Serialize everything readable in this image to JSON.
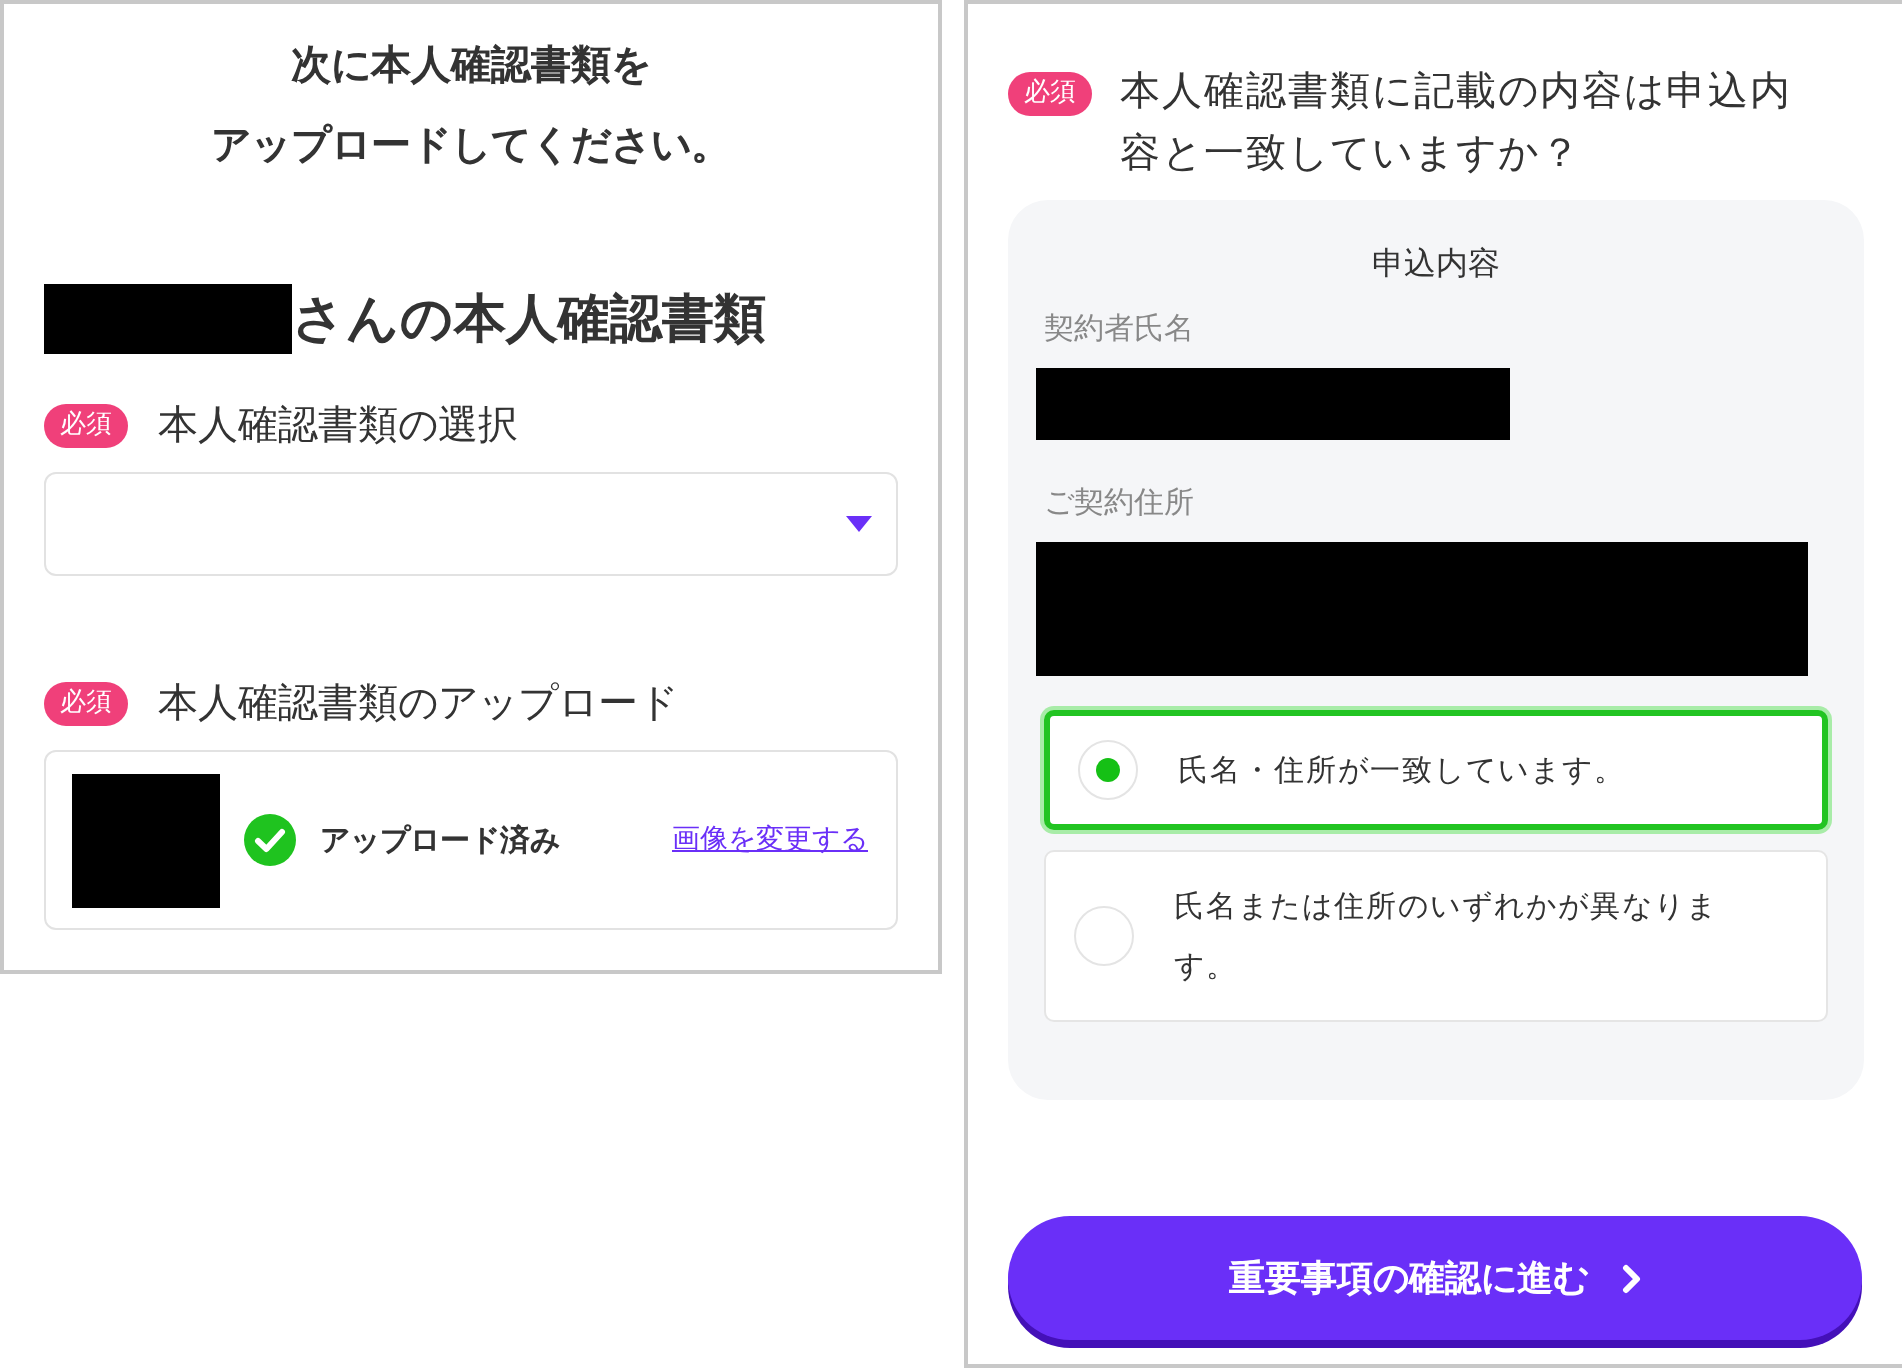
{
  "upload_panel": {
    "title_lines": [
      "次に本人確認書類を",
      "アップロードしてください。"
    ],
    "owner_heading": "さんの本人確認書類",
    "document_select": {
      "required_badge": "必須",
      "label": "本人確認書類の選択"
    },
    "upload": {
      "required_badge": "必須",
      "label": "本人確認書類のアップロード",
      "uploaded": true,
      "status": "アップロード済み",
      "change_link": "画像を変更する"
    }
  },
  "confirmation_panel": {
    "required_badge": "必須",
    "question": "本人確認書類に記載の内容は申込内容と一致していますか？",
    "summary": {
      "title": "申込内容",
      "fields": [
        {
          "label": "契約者氏名",
          "kind": "single_line"
        },
        {
          "label": "ご契約住所",
          "kind": "multi_line"
        }
      ]
    },
    "options": [
      {
        "label": "氏名・住所が一致しています。",
        "selected": true
      },
      {
        "label": "氏名または住所のいずれかが異なります。",
        "selected": false
      }
    ],
    "next_button": "重要事項の確認に進む"
  }
}
